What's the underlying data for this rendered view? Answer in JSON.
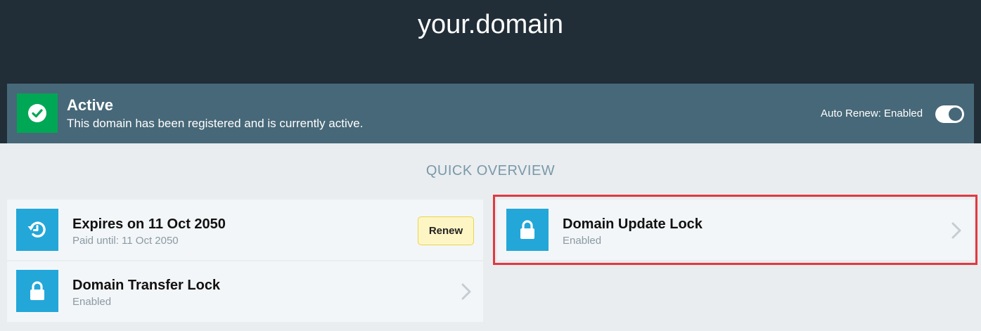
{
  "header": {
    "domain_title": "your.domain"
  },
  "status": {
    "title": "Active",
    "description": "This domain has been registered and is currently active.",
    "icon": "check-circle-icon",
    "color": "#00a755",
    "auto_renew_label": "Auto Renew: Enabled",
    "auto_renew_enabled": true
  },
  "overview": {
    "heading": "QUICK OVERVIEW",
    "cards": [
      {
        "title": "Expires on 11 Oct 2050",
        "subtitle": "Paid until: 11 Oct 2050",
        "icon": "renew-clock-icon",
        "button_label": "Renew"
      },
      {
        "title": "Domain Transfer Lock",
        "subtitle": "Enabled",
        "icon": "lock-icon"
      },
      {
        "title": "Domain Update Lock",
        "subtitle": "Enabled",
        "icon": "lock-icon",
        "highlighted": true
      }
    ]
  },
  "colors": {
    "header_bg": "#212e37",
    "status_bar_bg": "#476878",
    "icon_box": "#23a7d8",
    "highlight_border": "#e0393f",
    "renew_button_bg": "#fdf6c4"
  }
}
